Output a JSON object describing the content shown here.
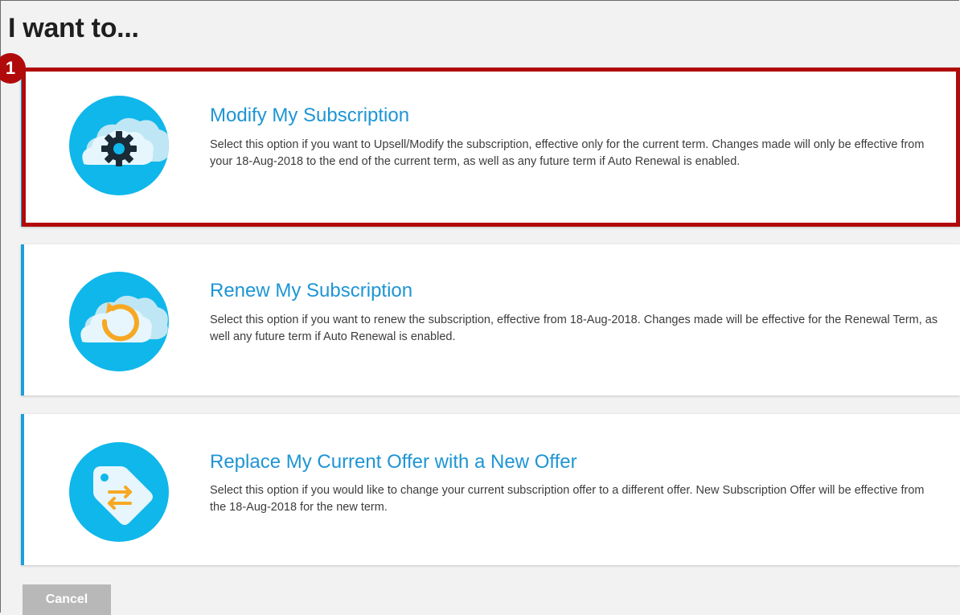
{
  "page": {
    "title": "I want to..."
  },
  "annotation": {
    "step_number": "1",
    "highlight_color": "#b10a0a"
  },
  "options": [
    {
      "title": "Modify My Subscription",
      "description": "Select this option if you want to Upsell/Modify the subscription, effective only for the current term. Changes made will only be effective from your 18-Aug-2018 to the end of the current term, as well as any future term if Auto Renewal is enabled.",
      "icon": "cloud-gear-icon"
    },
    {
      "title": "Renew My Subscription",
      "description": "Select this option if you want to renew the subscription, effective from 18-Aug-2018. Changes made will be effective for the Renewal Term, as well any future term if Auto Renewal is enabled.",
      "icon": "cloud-renew-icon"
    },
    {
      "title": "Replace My Current Offer with a New Offer",
      "description": "Select this option if you would like to change your current subscription offer to a different offer. New Subscription Offer will be effective from the 18-Aug-2018 for the new term.",
      "icon": "tag-swap-icon"
    }
  ],
  "footer": {
    "cancel_label": "Cancel"
  },
  "colors": {
    "accent": "#1ba0d7",
    "title_blue": "#1e95d4",
    "icon_circle": "#0fb7ea",
    "icon_orange": "#f7a823",
    "cancel_bg": "#b8b8b8"
  }
}
